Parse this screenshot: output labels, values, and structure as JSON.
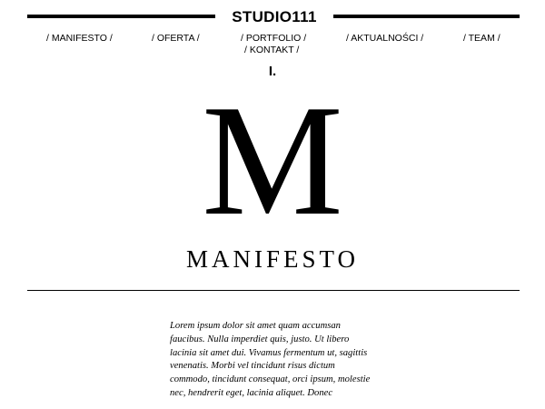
{
  "header": {
    "logo": "STUDIO111"
  },
  "nav": {
    "manifesto": "/ MANIFESTO /",
    "oferta": "/ OFERTA /",
    "portfolio": "/ PORTFOLIO /",
    "kontakt": "/ KONTAKT /",
    "aktualnosci": "/ AKTUALNOŚCI /",
    "team": "/ TEAM /"
  },
  "section": {
    "number": "I.",
    "letter": "M",
    "title": "MANIFESTO",
    "body": "Lorem ipsum dolor sit amet quam accumsan faucibus. Nulla imperdiet quis, justo. Ut libero lacinia sit amet dui. Vivamus fermentum ut, sagittis venenatis. Morbi vel tincidunt risus dictum commodo, tincidunt consequat, orci ipsum, molestie nec, hendrerit eget, lacinia aliquet. Donec"
  }
}
